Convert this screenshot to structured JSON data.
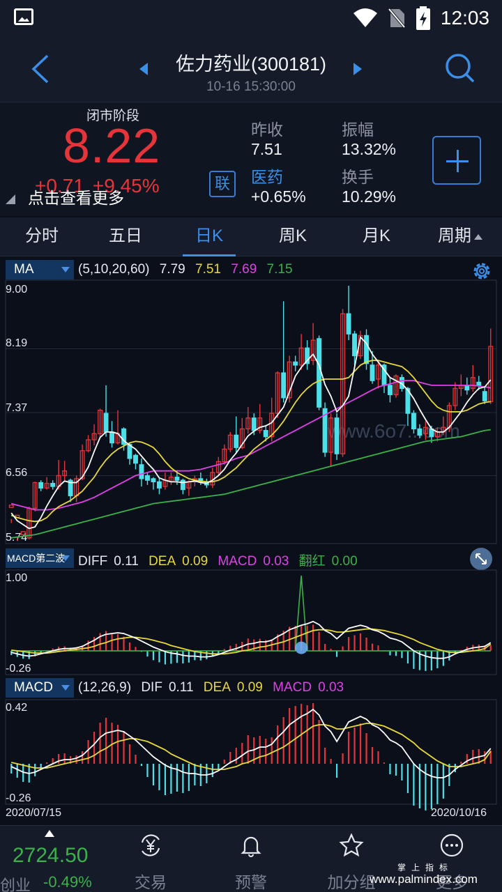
{
  "status": {
    "time": "12:03"
  },
  "header": {
    "title": "佐力药业(300181)",
    "subtitle": "10-16 15:30:00"
  },
  "quote": {
    "market_state": "闭市阶段",
    "price": "8.22",
    "change": "+0.71",
    "change_pct": "+9.45%",
    "more_tip": "点击查看更多",
    "lian": "联",
    "prev_close_label": "昨收",
    "prev_close": "7.51",
    "amplitude_label": "振幅",
    "amplitude": "13.32%",
    "sector_label": "医药",
    "sector_change": "+0.65%",
    "turnover_label": "换手",
    "turnover": "10.29%"
  },
  "tabs": [
    "分时",
    "五日",
    "日K",
    "周K",
    "月K",
    "周期"
  ],
  "active_tab": "日K",
  "ma": {
    "selector": "MA",
    "params": "(5,10,20,60)",
    "v5": "7.79",
    "v10": "7.51",
    "v20": "7.69",
    "v60": "7.15"
  },
  "macd2": {
    "selector": "MACD第二波",
    "diff_label": "DIFF",
    "diff": "0.11",
    "dea_label": "DEA",
    "dea": "0.09",
    "macd_label": "MACD",
    "macd": "0.03",
    "fanhong_label": "翻红",
    "fanhong": "0.00"
  },
  "macd": {
    "selector": "MACD",
    "params": "(12,26,9)",
    "dif_label": "DIF",
    "dif": "0.11",
    "dea_label": "DEA",
    "dea": "0.09",
    "macd_label": "MACD",
    "macd": "0.03"
  },
  "axes": {
    "k_ticks": [
      "9.00",
      "8.19",
      "7.37",
      "6.56",
      "5.74"
    ],
    "m2_ticks": [
      "1.00",
      "-0.26"
    ],
    "m_ticks": [
      "0.42",
      "-0.26"
    ],
    "start_date": "2020/07/15",
    "end_date": "2020/10/16"
  },
  "watermark": "www.6o7...com",
  "bottom": {
    "index_value": "2724.50",
    "index_name": "创业",
    "index_change": "-0.49%",
    "nav": [
      "交易",
      "预警",
      "加分组",
      "更多"
    ],
    "site": "www.palmindex.com",
    "site_cn": "掌上指标"
  },
  "colors": {
    "up": "#e5353a",
    "down": "#4de0e8",
    "ma5": "#ffffff",
    "ma10": "#e8d93a",
    "ma20": "#e040e8",
    "ma60": "#3ab24a",
    "accent": "#3d8ff0"
  },
  "chart_data": {
    "type": "candlestick",
    "candles": [
      [
        6.15,
        6.18,
        6.0,
        5.95
      ],
      [
        6.02,
        6.05,
        5.76,
        5.72
      ],
      [
        5.8,
        5.84,
        5.74,
        5.74
      ],
      [
        5.76,
        6.14,
        6.16,
        5.74
      ],
      [
        6.14,
        6.47,
        6.48,
        6.1
      ],
      [
        6.47,
        6.4,
        6.5,
        6.36
      ],
      [
        6.4,
        6.46,
        6.54,
        6.38
      ],
      [
        6.46,
        6.42,
        6.5,
        6.38
      ],
      [
        6.42,
        6.56,
        6.76,
        6.38
      ],
      [
        6.56,
        6.62,
        6.75,
        6.5
      ],
      [
        6.5,
        6.3,
        6.52,
        6.22
      ],
      [
        6.3,
        6.52,
        6.56,
        6.22
      ],
      [
        6.52,
        6.88,
        6.96,
        6.5
      ],
      [
        6.88,
        7.02,
        7.08,
        6.86
      ],
      [
        7.02,
        7.1,
        7.22,
        6.95
      ],
      [
        7.1,
        7.4,
        7.42,
        7.05
      ],
      [
        7.36,
        7.12,
        7.72,
        7.06
      ],
      [
        7.12,
        6.98,
        7.26,
        6.92
      ],
      [
        6.98,
        7.1,
        7.4,
        6.96
      ],
      [
        7.16,
        6.96,
        7.18,
        6.88
      ],
      [
        6.96,
        6.78,
        6.98,
        6.7
      ],
      [
        6.82,
        6.72,
        6.84,
        6.64
      ],
      [
        6.7,
        6.52,
        6.78,
        6.42
      ],
      [
        6.56,
        6.5,
        6.6,
        6.44
      ],
      [
        6.52,
        6.48,
        6.54,
        6.38
      ],
      [
        6.48,
        6.4,
        6.52,
        6.32
      ],
      [
        6.42,
        6.5,
        6.6,
        6.38
      ],
      [
        6.48,
        6.54,
        6.6,
        6.44
      ],
      [
        6.54,
        6.5,
        6.62,
        6.44
      ],
      [
        6.5,
        6.38,
        6.52,
        6.32
      ],
      [
        6.4,
        6.48,
        6.5,
        6.3
      ],
      [
        6.48,
        6.52,
        6.56,
        6.42
      ],
      [
        6.52,
        6.48,
        6.6,
        6.44
      ],
      [
        6.48,
        6.44,
        6.52,
        6.4
      ],
      [
        6.44,
        6.6,
        6.66,
        6.4
      ],
      [
        6.6,
        6.74,
        6.8,
        6.56
      ],
      [
        6.74,
        6.9,
        6.96,
        6.7
      ],
      [
        6.9,
        7.08,
        7.12,
        6.86
      ],
      [
        7.08,
        6.92,
        7.32,
        6.86
      ],
      [
        6.92,
        7.16,
        7.3,
        6.9
      ],
      [
        7.16,
        7.3,
        7.44,
        7.1
      ],
      [
        7.3,
        7.14,
        7.36,
        7.08
      ],
      [
        7.14,
        7.3,
        7.48,
        7.1
      ],
      [
        7.14,
        7.06,
        7.2,
        7.0
      ],
      [
        7.06,
        7.36,
        7.56,
        7.0
      ],
      [
        7.36,
        7.88,
        7.9,
        7.3
      ],
      [
        7.88,
        7.56,
        8.8,
        7.5
      ],
      [
        7.56,
        8.02,
        8.1,
        7.5
      ],
      [
        8.02,
        7.98,
        8.1,
        7.9
      ],
      [
        7.98,
        8.2,
        8.38,
        7.92
      ],
      [
        8.2,
        8.0,
        8.3,
        7.92
      ],
      [
        8.04,
        8.3,
        8.52,
        7.98
      ],
      [
        8.32,
        7.44,
        8.36,
        7.4
      ],
      [
        7.42,
        6.86,
        7.5,
        6.8
      ],
      [
        6.86,
        7.3,
        7.36,
        6.68
      ],
      [
        7.3,
        6.84,
        7.36,
        6.76
      ],
      [
        6.84,
        8.64,
        8.7,
        6.8
      ],
      [
        8.64,
        8.38,
        9.0,
        8.3
      ],
      [
        8.38,
        8.1,
        8.42,
        7.98
      ],
      [
        8.1,
        8.36,
        8.42,
        8.06
      ],
      [
        8.36,
        8.0,
        8.44,
        7.92
      ],
      [
        7.98,
        7.78,
        8.16,
        7.74
      ],
      [
        7.8,
        7.98,
        8.02,
        7.68
      ],
      [
        7.98,
        7.72,
        8.0,
        7.62
      ],
      [
        7.72,
        7.6,
        7.82,
        7.5
      ],
      [
        7.6,
        7.84,
        7.86,
        7.56
      ],
      [
        7.82,
        7.68,
        7.86,
        7.64
      ],
      [
        7.68,
        7.36,
        7.7,
        7.2
      ],
      [
        7.36,
        7.16,
        7.4,
        7.1
      ],
      [
        7.16,
        7.08,
        7.22,
        7.04
      ],
      [
        7.1,
        7.18,
        7.26,
        7.02
      ],
      [
        7.16,
        7.06,
        7.2,
        6.98
      ],
      [
        7.06,
        7.12,
        7.18,
        7.0
      ],
      [
        7.12,
        7.18,
        7.32,
        7.08
      ],
      [
        7.18,
        7.46,
        7.5,
        7.12
      ],
      [
        7.46,
        7.68,
        7.76,
        7.4
      ],
      [
        7.68,
        7.72,
        7.86,
        7.58
      ],
      [
        7.72,
        7.66,
        7.82,
        7.6
      ],
      [
        7.68,
        7.82,
        7.98,
        7.64
      ],
      [
        7.76,
        7.72,
        7.84,
        7.66
      ],
      [
        7.64,
        7.52,
        7.7,
        7.48
      ],
      [
        7.51,
        8.22,
        8.45,
        7.48
      ]
    ],
    "ma5": [
      6.08,
      5.98,
      5.93,
      5.88,
      5.9,
      6.02,
      6.17,
      6.3,
      6.42,
      6.49,
      6.47,
      6.47,
      6.54,
      6.67,
      6.87,
      7.05,
      7.12,
      7.12,
      7.1,
      7.01,
      6.95,
      6.9,
      6.81,
      6.72,
      6.64,
      6.53,
      6.5,
      6.48,
      6.48,
      6.47,
      6.48,
      6.49,
      6.47,
      6.46,
      6.5,
      6.56,
      6.64,
      6.76,
      6.85,
      6.96,
      7.07,
      7.13,
      7.18,
      7.2,
      7.24,
      7.34,
      7.44,
      7.64,
      7.84,
      7.95,
      8.04,
      8.12,
      7.98,
      7.73,
      7.58,
      7.38,
      7.46,
      7.58,
      7.95,
      8.34,
      8.26,
      8.12,
      8.02,
      7.92,
      7.82,
      7.78,
      7.74,
      7.66,
      7.55,
      7.41,
      7.28,
      7.16,
      7.12,
      7.12,
      7.18,
      7.28,
      7.38,
      7.5,
      7.6,
      7.68,
      7.7,
      7.79
    ],
    "ma10": [
      6.05,
      6.02,
      6.0,
      5.98,
      5.97,
      5.98,
      6.02,
      6.1,
      6.16,
      6.2,
      6.24,
      6.3,
      6.36,
      6.45,
      6.54,
      6.66,
      6.76,
      6.84,
      6.9,
      6.94,
      6.98,
      7.0,
      6.99,
      6.96,
      6.92,
      6.84,
      6.74,
      6.66,
      6.6,
      6.56,
      6.52,
      6.5,
      6.49,
      6.48,
      6.48,
      6.5,
      6.54,
      6.6,
      6.66,
      6.74,
      6.82,
      6.9,
      6.96,
      7.02,
      7.08,
      7.16,
      7.26,
      7.38,
      7.5,
      7.6,
      7.68,
      7.74,
      7.78,
      7.8,
      7.8,
      7.8,
      7.8,
      7.82,
      7.9,
      7.98,
      8.02,
      8.04,
      8.04,
      8.02,
      8.0,
      7.98,
      7.96,
      7.9,
      7.82,
      7.72,
      7.62,
      7.52,
      7.44,
      7.4,
      7.38,
      7.38,
      7.38,
      7.4,
      7.44,
      7.48,
      7.5,
      7.51
    ],
    "ma20": [
      6.2,
      6.18,
      6.16,
      6.14,
      6.12,
      6.12,
      6.12,
      6.13,
      6.14,
      6.16,
      6.18,
      6.2,
      6.22,
      6.25,
      6.28,
      6.32,
      6.36,
      6.4,
      6.44,
      6.48,
      6.52,
      6.56,
      6.58,
      6.6,
      6.62,
      6.62,
      6.62,
      6.62,
      6.62,
      6.62,
      6.62,
      6.63,
      6.64,
      6.66,
      6.68,
      6.7,
      6.72,
      6.75,
      6.78,
      6.8,
      6.82,
      6.86,
      6.9,
      6.94,
      6.98,
      7.02,
      7.06,
      7.1,
      7.14,
      7.18,
      7.22,
      7.26,
      7.3,
      7.34,
      7.38,
      7.42,
      7.46,
      7.5,
      7.54,
      7.58,
      7.62,
      7.66,
      7.7,
      7.72,
      7.74,
      7.76,
      7.78,
      7.78,
      7.78,
      7.76,
      7.74,
      7.72,
      7.72,
      7.72,
      7.72,
      7.72,
      7.72,
      7.72,
      7.72,
      7.71,
      7.7,
      7.69
    ],
    "ma60": [
      5.76,
      5.77,
      5.78,
      5.79,
      5.8,
      5.82,
      5.84,
      5.86,
      5.88,
      5.9,
      5.92,
      5.94,
      5.96,
      5.98,
      6.0,
      6.02,
      6.04,
      6.06,
      6.08,
      6.1,
      6.12,
      6.14,
      6.16,
      6.18,
      6.2,
      6.21,
      6.22,
      6.23,
      6.24,
      6.25,
      6.26,
      6.27,
      6.28,
      6.29,
      6.3,
      6.31,
      6.32,
      6.34,
      6.36,
      6.38,
      6.4,
      6.42,
      6.44,
      6.46,
      6.48,
      6.5,
      6.52,
      6.54,
      6.56,
      6.58,
      6.6,
      6.62,
      6.64,
      6.66,
      6.68,
      6.7,
      6.72,
      6.74,
      6.76,
      6.78,
      6.8,
      6.82,
      6.84,
      6.86,
      6.88,
      6.9,
      6.92,
      6.94,
      6.96,
      6.98,
      7.0,
      7.01,
      7.02,
      7.03,
      7.04,
      7.05,
      7.06,
      7.08,
      7.1,
      7.12,
      7.14,
      7.15
    ],
    "k_ylim": [
      5.74,
      9.0
    ],
    "macd_dif": [
      -0.02,
      -0.04,
      -0.06,
      -0.07,
      -0.06,
      -0.04,
      -0.02,
      0.0,
      0.02,
      0.03,
      0.03,
      0.04,
      0.06,
      0.1,
      0.14,
      0.19,
      0.22,
      0.23,
      0.24,
      0.23,
      0.2,
      0.17,
      0.13,
      0.09,
      0.05,
      0.02,
      -0.01,
      -0.03,
      -0.04,
      -0.06,
      -0.07,
      -0.07,
      -0.08,
      -0.08,
      -0.07,
      -0.05,
      -0.02,
      0.01,
      0.03,
      0.06,
      0.09,
      0.1,
      0.12,
      0.12,
      0.14,
      0.19,
      0.23,
      0.28,
      0.31,
      0.34,
      0.36,
      0.39,
      0.35,
      0.27,
      0.23,
      0.16,
      0.23,
      0.3,
      0.32,
      0.34,
      0.32,
      0.28,
      0.26,
      0.22,
      0.17,
      0.15,
      0.12,
      0.06,
      0.0,
      -0.04,
      -0.07,
      -0.09,
      -0.1,
      -0.1,
      -0.08,
      -0.04,
      -0.01,
      0.02,
      0.04,
      0.05,
      0.06,
      0.11
    ],
    "macd_dea": [
      0.01,
      0.0,
      -0.01,
      -0.02,
      -0.03,
      -0.03,
      -0.03,
      -0.02,
      -0.01,
      0.0,
      0.01,
      0.02,
      0.03,
      0.04,
      0.06,
      0.09,
      0.11,
      0.14,
      0.16,
      0.17,
      0.18,
      0.18,
      0.17,
      0.16,
      0.14,
      0.12,
      0.1,
      0.07,
      0.05,
      0.03,
      0.01,
      -0.01,
      -0.02,
      -0.03,
      -0.04,
      -0.04,
      -0.04,
      -0.03,
      -0.02,
      -0.0,
      0.01,
      0.03,
      0.05,
      0.06,
      0.08,
      0.1,
      0.12,
      0.15,
      0.18,
      0.21,
      0.24,
      0.27,
      0.28,
      0.28,
      0.27,
      0.25,
      0.25,
      0.26,
      0.27,
      0.28,
      0.29,
      0.29,
      0.28,
      0.27,
      0.25,
      0.23,
      0.21,
      0.18,
      0.15,
      0.11,
      0.08,
      0.05,
      0.02,
      -0.0,
      -0.02,
      -0.02,
      -0.02,
      -0.01,
      0.0,
      0.01,
      0.03,
      0.09
    ],
    "macd_ylim": [
      -0.26,
      0.42
    ],
    "macd2_ylim": [
      -0.26,
      1.0
    ],
    "macd2_spike_index": 49
  }
}
